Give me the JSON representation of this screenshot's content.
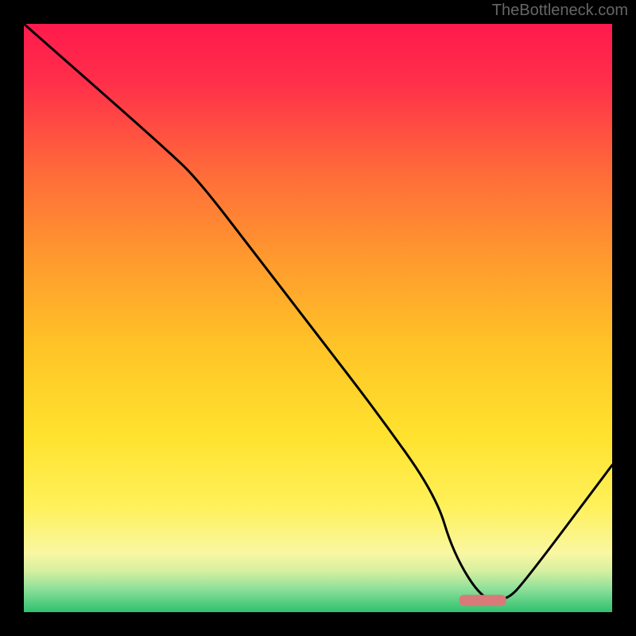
{
  "watermark": "TheBottleneck.com",
  "chart_data": {
    "type": "line",
    "title": "",
    "xlabel": "",
    "ylabel": "",
    "xlim": [
      0,
      100
    ],
    "ylim": [
      0,
      100
    ],
    "series": [
      {
        "name": "bottleneck-curve",
        "x": [
          0,
          25,
          30,
          40,
          50,
          60,
          70,
          73,
          78,
          82,
          85,
          100
        ],
        "values": [
          100,
          78,
          73,
          60,
          47,
          34,
          20,
          10,
          2,
          2,
          5,
          25
        ]
      }
    ],
    "marker": {
      "name": "optimal-range",
      "x_start": 74,
      "x_end": 82,
      "y": 2,
      "color": "#d87a7a"
    },
    "gradient_stops": [
      {
        "offset": 0.0,
        "color": "#ff1a4d"
      },
      {
        "offset": 0.1,
        "color": "#ff2f4a"
      },
      {
        "offset": 0.25,
        "color": "#ff6a3a"
      },
      {
        "offset": 0.4,
        "color": "#ff9a2e"
      },
      {
        "offset": 0.55,
        "color": "#ffc427"
      },
      {
        "offset": 0.7,
        "color": "#ffe22e"
      },
      {
        "offset": 0.82,
        "color": "#fff15a"
      },
      {
        "offset": 0.9,
        "color": "#f9f7a2"
      },
      {
        "offset": 0.93,
        "color": "#d6f0a0"
      },
      {
        "offset": 0.96,
        "color": "#8fe09a"
      },
      {
        "offset": 1.0,
        "color": "#2fc070"
      }
    ]
  }
}
